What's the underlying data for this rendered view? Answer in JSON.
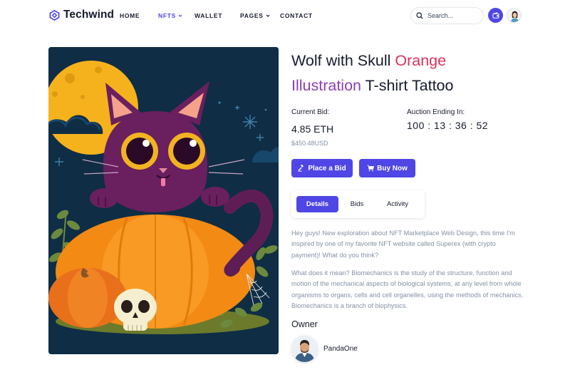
{
  "brand": {
    "name": "Techwind",
    "color": "#4f46e5"
  },
  "nav": {
    "items": [
      {
        "label": "HOME",
        "active": false,
        "dropdown": false
      },
      {
        "label": "NFTS",
        "active": true,
        "dropdown": true
      },
      {
        "label": "WALLET",
        "active": false,
        "dropdown": false
      },
      {
        "label": "PAGES",
        "active": false,
        "dropdown": true
      },
      {
        "label": "CONTACT",
        "active": false,
        "dropdown": false
      }
    ],
    "search_placeholder": "Search...",
    "icons": [
      "search-icon",
      "wallet-icon",
      "user-avatar"
    ]
  },
  "item": {
    "title_parts": [
      {
        "text": "Wolf with Skull ",
        "color": "#161c2d"
      },
      {
        "text": "Orange",
        "color": "#d8315b"
      },
      {
        "text": "Illustration",
        "color": "#8b3fb5"
      },
      {
        "text": " T-shirt Tattoo",
        "color": "#161c2d"
      }
    ],
    "current_bid_label": "Current Bid:",
    "current_bid_value": "4.85 ETH",
    "current_bid_usd": "$450.48USD",
    "auction_label": "Auction Ending In:",
    "auction_timer": "100 : 13 : 36 : 52",
    "place_bid_label": "Place a Bid",
    "buy_now_label": "Buy Now",
    "tabs": [
      {
        "label": "Details",
        "active": true
      },
      {
        "label": "Bids",
        "active": false
      },
      {
        "label": "Activity",
        "active": false
      }
    ],
    "description_1": "Hey guys! New exploration about NFT Marketplace Web Design, this time I'm inspired by one of my favorite NFT website called Superex (with crypto payment)! What do you think?",
    "description_2": "What does it mean? Biomechanics is the study of the structure, function and motion of the mechanical aspects of biological systems, at any level from whole organisms to organs, cells and cell organelles, using the methods of mechanics. Biomechanics is a branch of biophysics.",
    "owner_heading": "Owner",
    "owner_name": "PandaOne"
  },
  "colors": {
    "accent": "#4f46e5",
    "text": "#161c2d",
    "muted": "#8492a6",
    "title_orange": "#d8315b",
    "title_purple": "#8b3fb5"
  }
}
